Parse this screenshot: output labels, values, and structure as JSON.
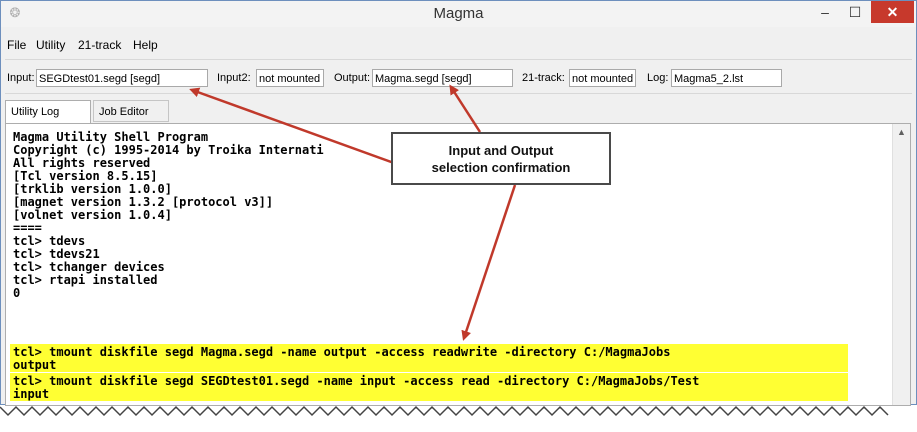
{
  "window": {
    "title": "Magma"
  },
  "menu": [
    "File",
    "Utility",
    "21-track",
    "Help"
  ],
  "status": {
    "input_label": "Input:",
    "input_value": "SEGDtest01.segd [segd]",
    "input2_label": "Input2:",
    "input2_value": "not mounted",
    "output_label": "Output:",
    "output_value": "Magma.segd [segd]",
    "track21_label": "21-track:",
    "track21_value": "not mounted",
    "log_label": "Log:",
    "log_value": "Magma5_2.lst"
  },
  "tabs": [
    "Utility Log",
    "Job Editor"
  ],
  "console": {
    "lines": [
      "Magma Utility Shell Program",
      "Copyright (c) 1995-2014 by Troika Internati",
      "All rights reserved",
      "[Tcl version 8.5.15]",
      "[trklib version 1.0.0]",
      "[magnet version 1.3.2 [protocol v3]]",
      "[volnet version 1.0.4]",
      "====",
      "tcl> tdevs",
      "tcl> tdevs21",
      "tcl> tchanger devices",
      "tcl> rtapi installed",
      "0",
      "tcl> tmount diskfile segd Magma.segd -name output -access readwrite -directory C:/MagmaJobs",
      "output",
      "tcl> tmount diskfile segd SEGDtest01.segd -name input -access read -directory C:/MagmaJobs/Test",
      "input"
    ]
  },
  "callout": {
    "line1": "Input and Output",
    "line2": "selection confirmation"
  },
  "colors": {
    "highlight": "#ffff33",
    "arrow": "#c0392b",
    "close_button": "#c7392c"
  }
}
